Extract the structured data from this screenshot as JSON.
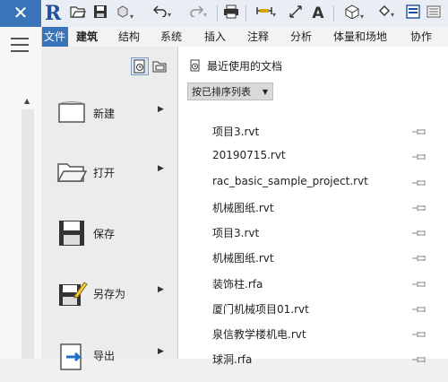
{
  "quick_access": {
    "close_glyph": "✕",
    "logo_letter": "R",
    "text_tool_glyph": "A",
    "tools": [
      "open-icon",
      "save-icon",
      "sync-icon",
      "undo-icon",
      "redo-icon",
      "print-icon",
      "measure-icon",
      "dimension-icon",
      "text-icon",
      "3d-view-icon",
      "section-icon",
      "switch-windows-icon"
    ]
  },
  "ribbon": {
    "tabs": [
      "文件",
      "建筑",
      "结构",
      "系统",
      "插入",
      "注释",
      "分析",
      "体量和场地",
      "协作"
    ],
    "active_tab": "建筑",
    "file_tab_color": "#3a74b8"
  },
  "app_menu": {
    "items": [
      {
        "label": "新建",
        "icon": "new-document-icon",
        "has_submenu": true
      },
      {
        "label": "打开",
        "icon": "open-folder-icon",
        "has_submenu": true
      },
      {
        "label": "保存",
        "icon": "save-disk-icon",
        "has_submenu": false
      },
      {
        "label": "另存为",
        "icon": "save-as-icon",
        "has_submenu": true
      },
      {
        "label": "导出",
        "icon": "export-icon",
        "has_submenu": true
      }
    ]
  },
  "recent": {
    "title": "最近使用的文档",
    "sort_label": "按已排序列表",
    "documents": [
      "项目3.rvt",
      "20190715.rvt",
      "rac_basic_sample_project.rvt",
      "机械图纸.rvt",
      "项目3.rvt",
      "机械图纸.rvt",
      "装饰柱.rfa",
      "厦门机械项目01.rvt",
      "泉信教学楼机电.rvt",
      "球洞.rfa"
    ]
  }
}
